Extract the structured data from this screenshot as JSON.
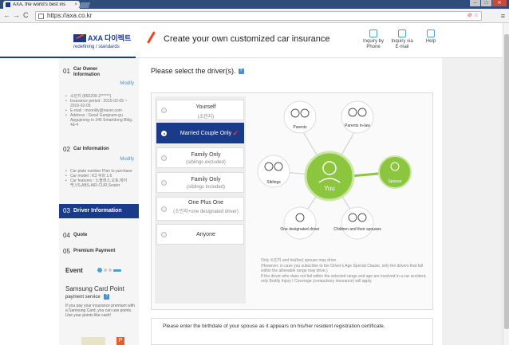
{
  "browser": {
    "tab_title": "AXA, the world's best ins",
    "tab_close": "×",
    "url": "https://axa.co.kr",
    "nav_back": "←",
    "nav_forward": "→",
    "nav_reload": "C",
    "menu": "≡"
  },
  "header": {
    "logo_text": "AXA 다이렉트",
    "logo_sub": "redefining / standards",
    "title": "Create your own customized car insurance",
    "links": [
      {
        "label": "Inquiry by Phone"
      },
      {
        "label": "Inquiry via E-mail"
      },
      {
        "label": "Help"
      }
    ]
  },
  "sidebar": {
    "modify_label": "Modify",
    "steps": [
      {
        "num": "01",
        "title": "Car Owner Information"
      },
      {
        "num": "02",
        "title": "Car Information"
      },
      {
        "num": "03",
        "title": "Driver Information"
      },
      {
        "num": "04",
        "title": "Quote"
      },
      {
        "num": "05",
        "title": "Premium Payment"
      }
    ],
    "owner_info": [
      "소민지 (850209-2******)",
      "Insurance period : 2015-02-05 ~ 2016-02-05",
      "E-mail : moonlily@naver.com",
      "Address : Seoul Gangnam-gu Apgujeong-ro 346 Smartdong Bldg. 4d-4"
    ],
    "car_info": [
      "Car plate number Plan to purchase",
      "Car model : K3 쿠프 1.6",
      "Car features : 노블레스,오토,에어백,VS,ABS,AIR-CUR,Seater"
    ],
    "event": {
      "title": "Event",
      "card_title": "Samsung Card Point",
      "card_sub": "payment service",
      "card_desc": "If you pay your insurance premium with a Samsung Card, you can use points. Use your points like cash!",
      "badge": "P"
    }
  },
  "main": {
    "section_title": "Please select the driver(s).",
    "help": "?",
    "options": [
      {
        "main": "Yourself",
        "sub": "(소민지)"
      },
      {
        "main": "Married Couple Only",
        "sub": ""
      },
      {
        "main": "Family Only",
        "sub": "(siblings excluded)"
      },
      {
        "main": "Family Only",
        "sub": "(siblings included)"
      },
      {
        "main": "One Plus One",
        "sub": "(소민지+one designated driver)"
      },
      {
        "main": "Anyone",
        "sub": ""
      }
    ],
    "selected_check": "✔",
    "diagram": {
      "parents": "Parents",
      "parents_in_law": "Parents in-law",
      "siblings": "Siblings",
      "you": "You",
      "spouse": "Spouse",
      "one_designated": "One designated driver",
      "children": "Children and their spouses"
    },
    "notes": [
      "Only 소민지 and his(her) spouse may drive.",
      "(However, in case you subscribe to the Driver's Age Special Clause, only the drivers that fall within the allowable range may drive.)",
      "If the driver who does not fall within the selected range and age are involved in a car accident, only Bodily Injury I Coverage (compulsory insurance) will apply."
    ],
    "birth_prompt": "Please enter the birthdate of your spouse as it appears on his/her resident registration certificate."
  }
}
